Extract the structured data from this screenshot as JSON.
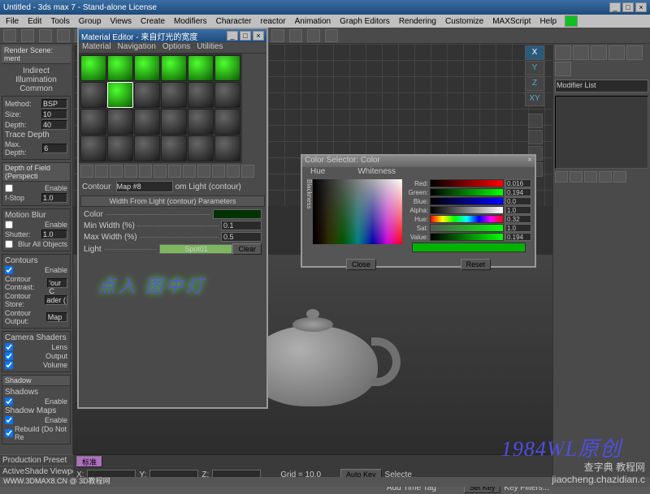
{
  "app": {
    "title": "Untitled - 3ds max 7 - Stand-alone License"
  },
  "menu": [
    "File",
    "Edit",
    "Tools",
    "Group",
    "Views",
    "Create",
    "Modifiers",
    "Character",
    "reactor",
    "Animation",
    "Graph Editors",
    "Rendering",
    "Customize",
    "MAXScript",
    "Help"
  ],
  "left": {
    "render_title": "Render Scene: ment",
    "indirect": "Indirect Illumination",
    "common": "Common",
    "method_lbl": "Method:",
    "method_val": "BSP",
    "size_lbl": "Size:",
    "size_val": "10",
    "depth_lbl": "Depth:",
    "depth_val": "40",
    "trace_depth": "Trace Depth",
    "maxdepth_lbl": "Max. Depth:",
    "maxdepth_val": "6",
    "dof_hdr": "Depth of Field (Perspecti",
    "enable": "Enable",
    "fstop_lbl": "f-Stop",
    "fstop_val": "1.0",
    "motion_blur": "Motion Blur",
    "shutter_lbl": "Shutter:",
    "shutter_val": "1.0",
    "blur_all": "Blur All Objects",
    "contours": "Contours",
    "cc_lbl": "Contour Contrast:",
    "cc_val": "'our C",
    "cs_lbl": "Contour Store:",
    "cs_val": "ader (",
    "co_lbl": "Contour Output:",
    "co_val": "Map",
    "camera_shaders": "Camera Shaders",
    "lens": "Lens",
    "output": "Output",
    "volume": "Volume",
    "shadow_hdr": "Shadow",
    "shadows": "Shadows",
    "shadow_maps": "Shadow Maps",
    "rebuild": "Rebuild (Do Not Re",
    "production": "Production",
    "preset": "Preset",
    "activeshade": "ActiveShade",
    "viewport": "Viewport"
  },
  "mat": {
    "title": "Material Editor - 来自灯光的宽度",
    "menu": [
      "Material",
      "Navigation",
      "Options",
      "Utilities"
    ],
    "contour_lbl": "Contour",
    "map_name": "Map #8",
    "mode": "om Light (contour)",
    "rollout": "Width From Light (contour) Parameters",
    "color": "Color",
    "minw": "Min Width (%)",
    "minw_val": "0.1",
    "maxw": "Max Width (%)",
    "maxw_val": "0.5",
    "light": "Light",
    "light_val": "Spot01",
    "clear": "Clear"
  },
  "annotation": "点入 图中灯",
  "colorsel": {
    "title": "Color Selector: Color",
    "hue": "Hue",
    "whiteness": "Whiteness",
    "blackness": "Blackness",
    "red": "Red:",
    "red_val": "0.016",
    "green": "Green:",
    "green_val": "0.194",
    "blue": "Blue:",
    "blue_val": "0.0",
    "alpha": "Alpha:",
    "alpha_val": "1.0",
    "hue2": "Hue:",
    "hue_val": "0.32",
    "sat": "Sat:",
    "sat_val": "1.0",
    "value": "Value:",
    "value_val": "0.194",
    "close": "Close",
    "reset": "Reset"
  },
  "right": {
    "modifier_list": "Modifier List"
  },
  "axis": {
    "x": "X",
    "y": "Y",
    "z": "Z",
    "xy": "XY"
  },
  "timeline": {
    "x": "X:",
    "y": "Y:",
    "z": "Z:",
    "grid": "Grid = 10.0",
    "addtag": "Add Time Tag",
    "autokey": "Auto Key",
    "selecte": "Selecte",
    "setkey": "Set Key",
    "keyfilters": "Key Filters..."
  },
  "watermark1": "1984WL原创",
  "watermark2": "查字典 教程网\njiaocheng.chazidian.c",
  "watermark3": "WWW.3DMAX8.CN @ 3D教程网",
  "standard_btn": "标准"
}
